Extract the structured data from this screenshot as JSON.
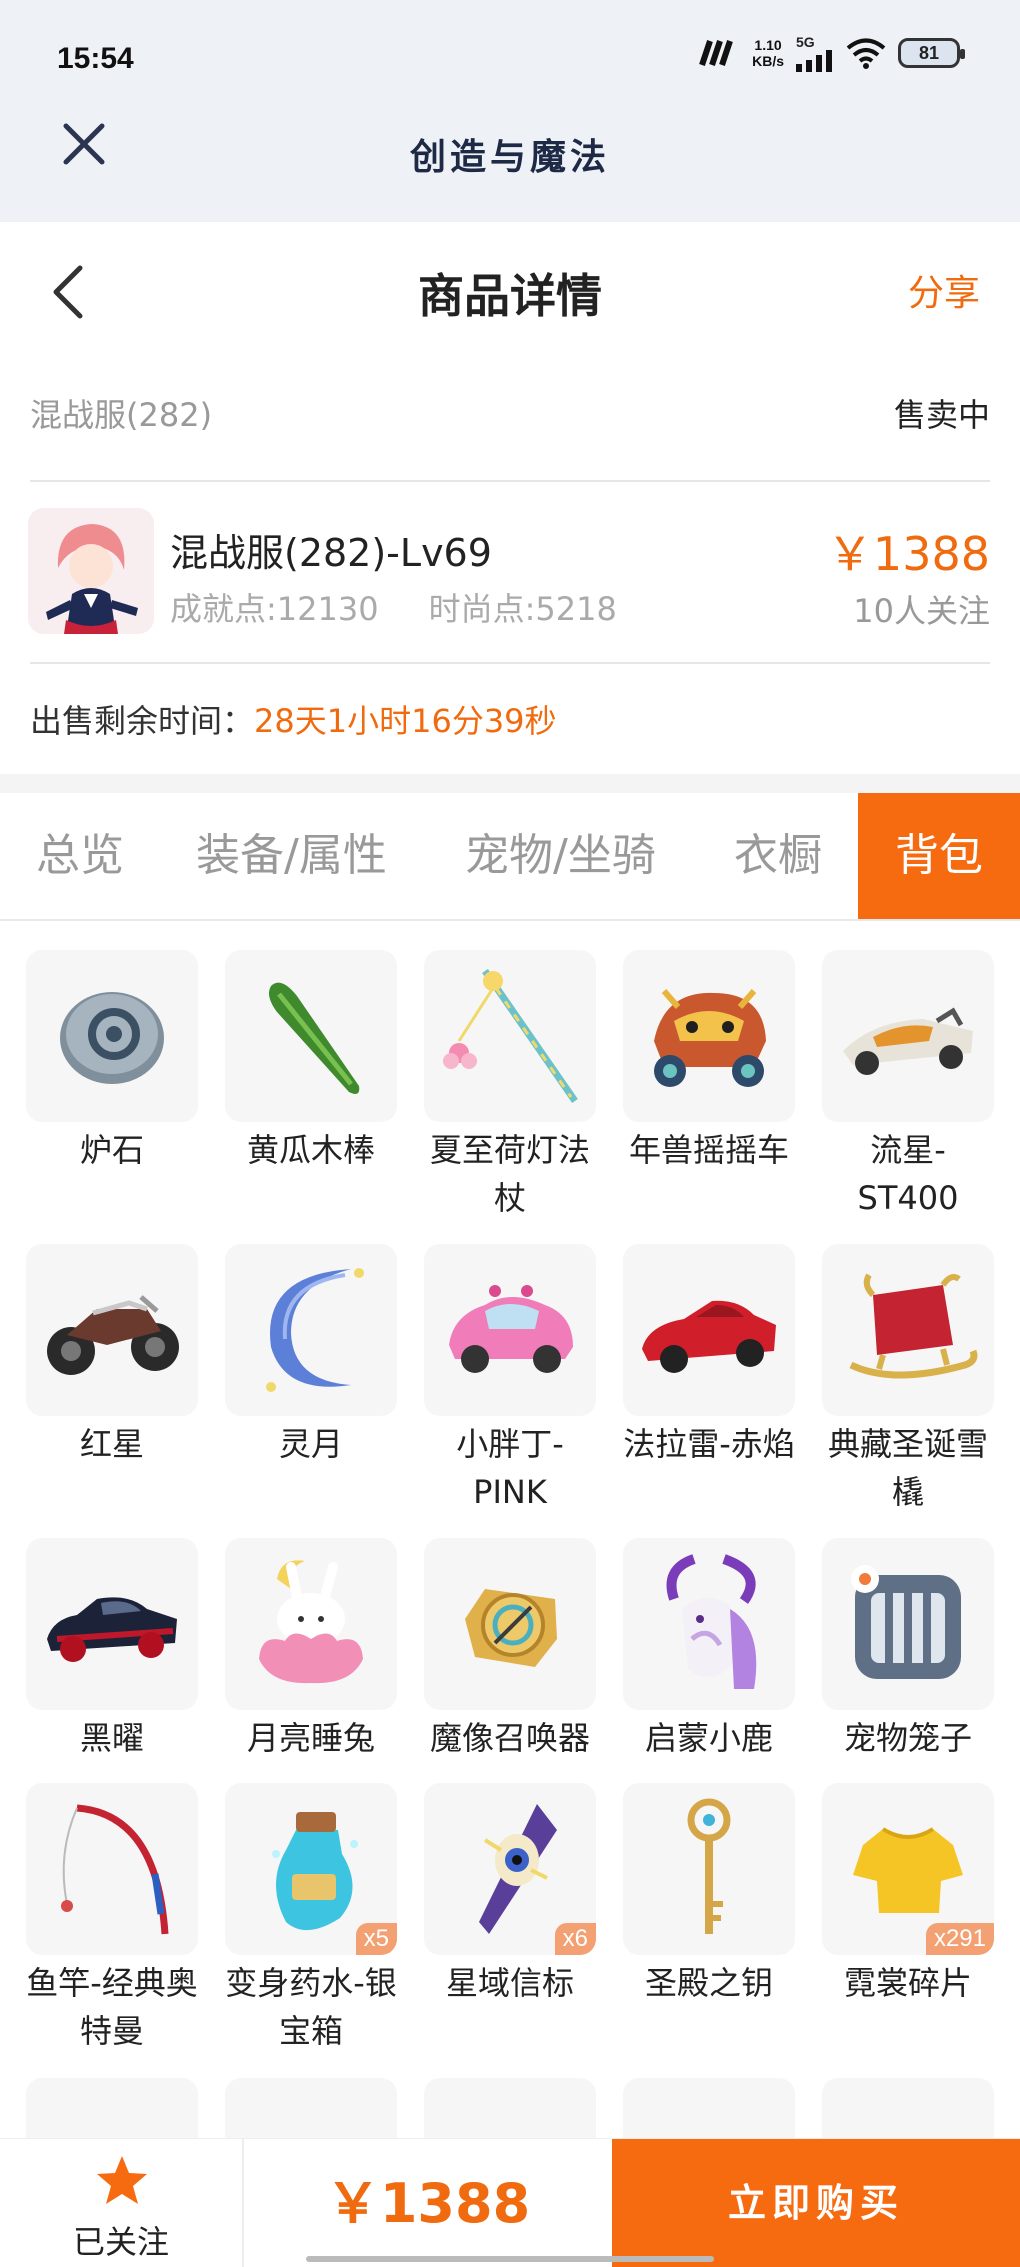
{
  "status_bar": {
    "time": "15:54",
    "net_speed_value": "1.10",
    "net_speed_unit": "KB/s",
    "network": "5G",
    "battery": "81"
  },
  "app": {
    "title": "创造与魔法"
  },
  "page": {
    "title": "商品详情",
    "share_label": "分享"
  },
  "listing": {
    "server": "混战服(282)",
    "status": "售卖中",
    "product_title": "混战服(282)-Lv69",
    "achievement": "成就点:12130",
    "fashion": "时尚点:5218",
    "price": "￥1388",
    "followers": "10人关注",
    "remaining_label": "出售剩余时间：",
    "remaining_value": "28天1小时16分39秒"
  },
  "tabs": [
    {
      "label": "总览",
      "active": false
    },
    {
      "label": "装备/属性",
      "active": false
    },
    {
      "label": "宠物/坐骑",
      "active": false
    },
    {
      "label": "衣橱",
      "active": false
    },
    {
      "label": "背包",
      "active": true
    }
  ],
  "items": [
    {
      "name": "炉石",
      "icon": "stone-icon",
      "count": ""
    },
    {
      "name": "黄瓜木棒",
      "icon": "cucumber-stick-icon",
      "count": ""
    },
    {
      "name": "夏至荷灯法杖",
      "icon": "lotus-staff-icon",
      "count": ""
    },
    {
      "name": "年兽摇摇车",
      "icon": "nian-ride-icon",
      "count": ""
    },
    {
      "name": "流星-ST400",
      "icon": "racer-icon",
      "count": ""
    },
    {
      "name": "红星",
      "icon": "motorcycle-icon",
      "count": ""
    },
    {
      "name": "灵月",
      "icon": "crescent-moon-icon",
      "count": ""
    },
    {
      "name": "小胖丁-PINK",
      "icon": "pink-car-icon",
      "count": ""
    },
    {
      "name": "法拉雷-赤焰",
      "icon": "red-sportscar-icon",
      "count": ""
    },
    {
      "name": "典藏圣诞雪橇",
      "icon": "sleigh-icon",
      "count": ""
    },
    {
      "name": "黑曜",
      "icon": "black-car-icon",
      "count": ""
    },
    {
      "name": "月亮睡兔",
      "icon": "moon-rabbit-icon",
      "count": ""
    },
    {
      "name": "魔像召唤器",
      "icon": "golem-summoner-icon",
      "count": ""
    },
    {
      "name": "启蒙小鹿",
      "icon": "deer-icon",
      "count": ""
    },
    {
      "name": "宠物笼子",
      "icon": "pet-cage-icon",
      "count": ""
    },
    {
      "name": "鱼竿-经典奥特曼",
      "icon": "fishing-rod-icon",
      "count": ""
    },
    {
      "name": "变身药水-银宝箱",
      "icon": "potion-icon",
      "count": "x5"
    },
    {
      "name": "星域信标",
      "icon": "star-beacon-icon",
      "count": "x6"
    },
    {
      "name": "圣殿之钥",
      "icon": "key-icon",
      "count": ""
    },
    {
      "name": "霓裳碎片",
      "icon": "shirt-fragment-icon",
      "count": "x291"
    }
  ],
  "bottom_bar": {
    "follow_label": "已关注",
    "price": "￥1388",
    "buy_label": "立即购买"
  },
  "colors": {
    "accent": "#f66b10",
    "price": "#f06b0f"
  }
}
